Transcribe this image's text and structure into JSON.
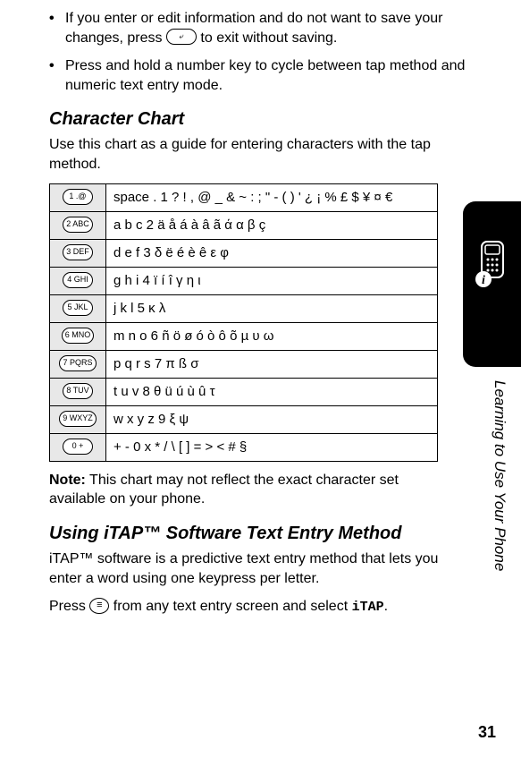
{
  "bullets": [
    {
      "pre": "If you enter or edit information and do not want to save your changes, press ",
      "key": "⤶",
      "post": " to exit without saving."
    },
    {
      "pre": "Press and hold a number key to cycle between tap method and numeric text entry mode.",
      "key": "",
      "post": ""
    }
  ],
  "section1": {
    "title": "Character Chart",
    "intro": "Use this chart as a guide for entering characters with the tap method."
  },
  "chart": [
    {
      "key": "1 .@",
      "chars": "space  .  1  ?  !  ,  @  _  &  ~  :  ;  \"  -  (  )  '  ¿  ¡  %  £  $  ¥  ¤  €"
    },
    {
      "key": "2 ABC",
      "chars": "a  b  c  2  ä  å  á  à  â  ã  ά  α  β  ç"
    },
    {
      "key": "3 DEF",
      "chars": "d  e  f  3  δ  ë  é  è  ê  ε  φ"
    },
    {
      "key": "4 GHI",
      "chars": "g  h  i  4  ï  í  î  γ  η  ι"
    },
    {
      "key": "5 JKL",
      "chars": "j  k  l  5  κ  λ"
    },
    {
      "key": "6 MNO",
      "chars": "m  n  o  6  ñ  ö  ø  ó  ò  ô  õ  µ  υ  ω"
    },
    {
      "key": "7 PQRS",
      "chars": "p  q  r  s  7  π  ß  σ"
    },
    {
      "key": "8 TUV",
      "chars": "t  u  v  8  θ  ü  ú  ù  û  τ"
    },
    {
      "key": "9 WXYZ",
      "chars": "w  x  y  z  9  ξ  ψ"
    },
    {
      "key": "0 +",
      "chars": "+  -  0  x  *  /  \\  [  ]  =  >  <  #  §"
    }
  ],
  "note": {
    "label": "Note:",
    "text": " This chart may not reflect the exact character set available on your phone."
  },
  "section2": {
    "title": "Using iTAP™ Software Text Entry Method",
    "p1": "iTAP™ software is a predictive text entry method that lets you enter a word using one keypress per letter.",
    "p2_pre": "Press ",
    "p2_post": " from any text entry screen and select ",
    "itap": "iTAP",
    "p2_end": "."
  },
  "side": {
    "label": "Learning to Use Your Phone"
  },
  "page_number": "31"
}
